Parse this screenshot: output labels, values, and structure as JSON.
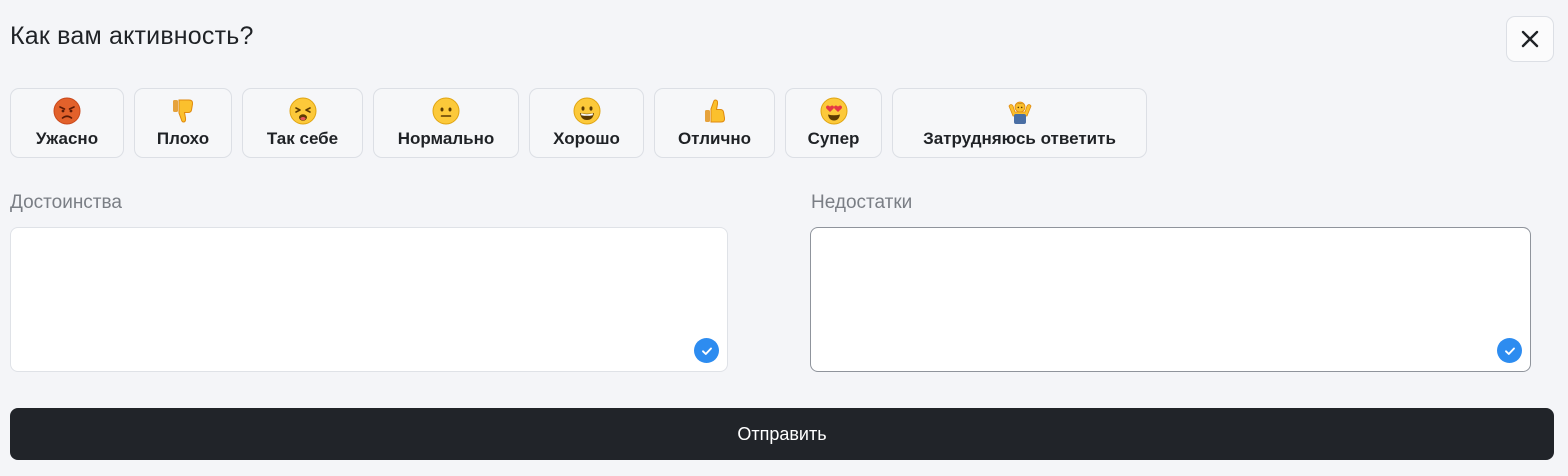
{
  "dialog": {
    "title": "Как вам активность?",
    "close_icon": "close-icon"
  },
  "ratings": [
    {
      "label": "Ужасно",
      "icon": "angry-face-icon"
    },
    {
      "label": "Плохо",
      "icon": "thumbs-down-icon"
    },
    {
      "label": "Так себе",
      "icon": "tired-face-icon"
    },
    {
      "label": "Нормально",
      "icon": "neutral-face-icon"
    },
    {
      "label": "Хорошо",
      "icon": "grinning-face-icon"
    },
    {
      "label": "Отлично",
      "icon": "thumbs-up-icon"
    },
    {
      "label": "Супер",
      "icon": "heart-eyes-face-icon"
    },
    {
      "label": "Затрудняюсь ответить",
      "icon": "person-shrugging-icon"
    }
  ],
  "fields": {
    "pros": {
      "label": "Достоинства",
      "value": "",
      "placeholder": ""
    },
    "cons": {
      "label": "Недостатки",
      "value": "",
      "placeholder": ""
    }
  },
  "submit": {
    "label": "Отправить"
  },
  "colors": {
    "background": "#f4f5f8",
    "accent": "#2d8cf0",
    "button_dark": "#212429"
  }
}
